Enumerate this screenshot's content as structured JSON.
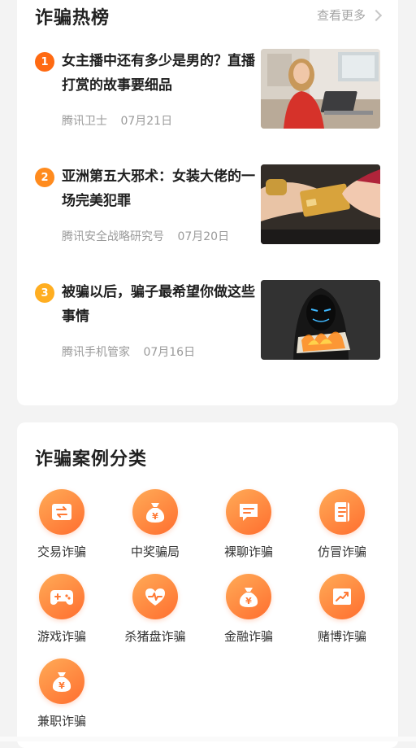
{
  "hot": {
    "title": "诈骗热榜",
    "more": "查看更多",
    "articles": [
      {
        "rank": "1",
        "title": "女主播中还有多少是男的？直播打赏的故事要细品",
        "source": "腾讯卫士",
        "date": "07月21日",
        "rank_color": "#ff6a12"
      },
      {
        "rank": "2",
        "title": "亚洲第五大邪术：女装大佬的一场完美犯罪",
        "source": "腾讯安全战略研究号",
        "date": "07月20日",
        "rank_color": "#ff8b1e"
      },
      {
        "rank": "3",
        "title": "被骗以后，骗子最希望你做这些事情",
        "source": "腾讯手机管家",
        "date": "07月16日",
        "rank_color": "#ffae21"
      }
    ]
  },
  "categories": {
    "title": "诈骗案例分类",
    "items": [
      {
        "label": "交易诈骗",
        "icon": "exchange-icon"
      },
      {
        "label": "中奖骗局",
        "icon": "money-bag-icon"
      },
      {
        "label": "裸聊诈骗",
        "icon": "chat-bubble-icon"
      },
      {
        "label": "仿冒诈骗",
        "icon": "document-copy-icon"
      },
      {
        "label": "游戏诈骗",
        "icon": "gamepad-icon"
      },
      {
        "label": "杀猪盘诈骗",
        "icon": "heart-pulse-icon"
      },
      {
        "label": "金融诈骗",
        "icon": "money-bag-icon"
      },
      {
        "label": "赌博诈骗",
        "icon": "trend-chart-icon"
      },
      {
        "label": "兼职诈骗",
        "icon": "money-bag-icon"
      }
    ]
  }
}
